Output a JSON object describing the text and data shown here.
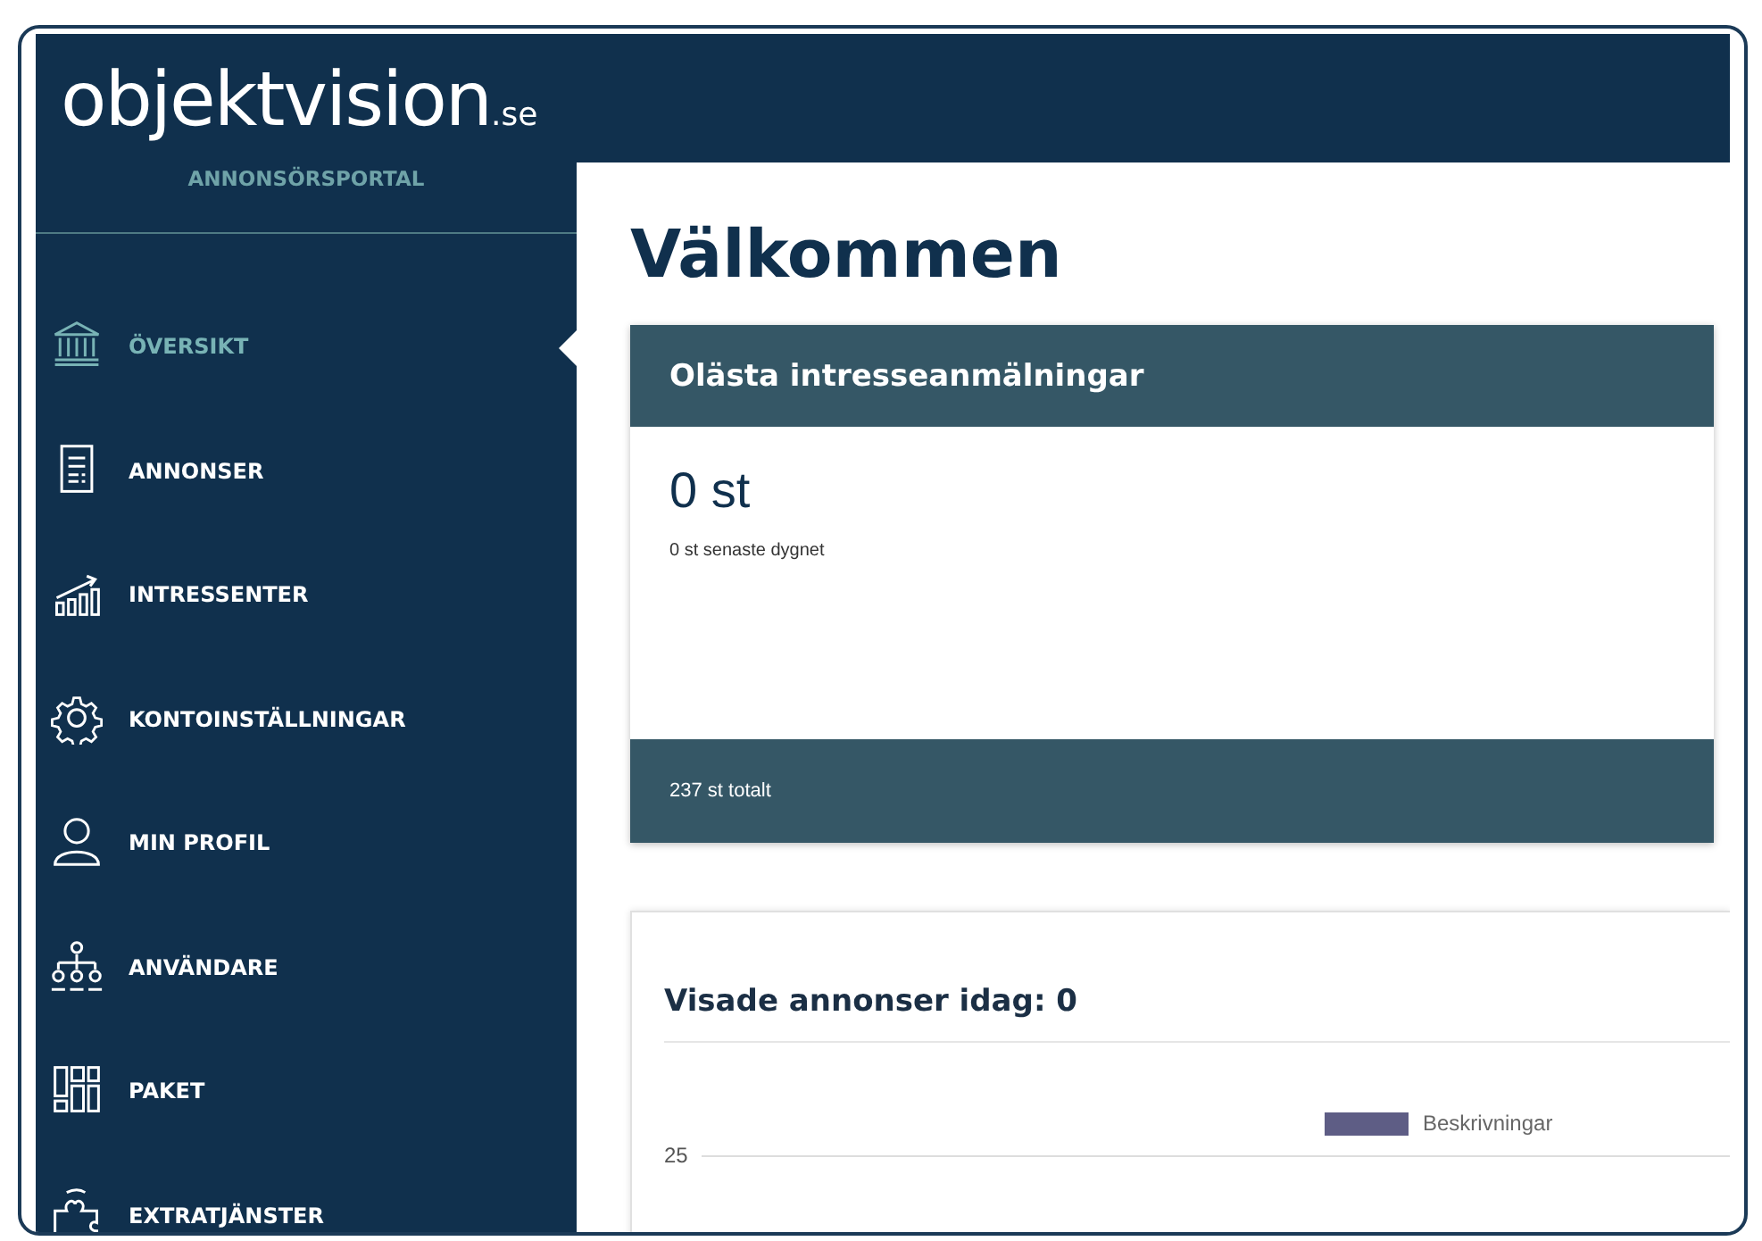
{
  "header": {
    "logo": "objektvision",
    "logo_suffix": ".se"
  },
  "sidebar": {
    "portal_label": "ANNONSÖRSPORTAL",
    "items": [
      {
        "label": "ÖVERSIKT",
        "kind": "bank",
        "selected": true
      },
      {
        "label": "ANNONSER",
        "kind": "document",
        "selected": false
      },
      {
        "label": "INTRESSENTER",
        "kind": "growth",
        "selected": false
      },
      {
        "label": "KONTOINSTÄLLNINGAR",
        "kind": "gear",
        "selected": false
      },
      {
        "label": "MIN PROFIL",
        "kind": "person",
        "selected": false
      },
      {
        "label": "ANVÄNDARE",
        "kind": "org",
        "selected": false
      },
      {
        "label": "PAKET",
        "kind": "grid",
        "selected": false
      },
      {
        "label": "EXTRATJÄNSTER",
        "kind": "puzzle",
        "selected": false
      }
    ]
  },
  "main": {
    "title": "Välkommen",
    "unread_card": {
      "title": "Olästa intresseanmälningar",
      "count": "0 st",
      "recent": "0 st senaste dygnet",
      "total": "237 st totalt"
    },
    "views_card": {
      "title": "Visade annonser idag: 0",
      "chart": {
        "legend": [
          {
            "name": "Beskrivningar",
            "color": "#5e5d85"
          }
        ],
        "y_tick": "25"
      }
    }
  }
}
